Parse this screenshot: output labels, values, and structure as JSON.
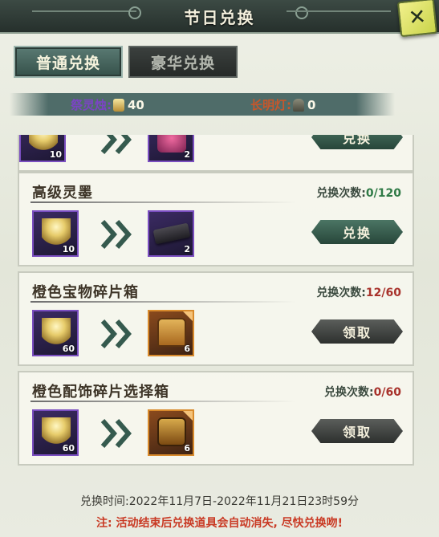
{
  "header": {
    "title": "节日兑换",
    "close_label": "✕"
  },
  "tabs": [
    {
      "label": "普通兑换"
    },
    {
      "label": "豪华兑换"
    }
  ],
  "currency": [
    {
      "label": "祭灵烛:",
      "value": "40",
      "icon": "candle-icon"
    },
    {
      "label": "长明灯:",
      "value": "0",
      "icon": "lamp-icon"
    }
  ],
  "rows": [
    {
      "name": "",
      "count_label": "",
      "count_value": "",
      "input_qty": "10",
      "output_qty": "2",
      "button": "兑换"
    },
    {
      "name": "高级灵墨",
      "count_label": "兑换次数:",
      "count_value": "0/120",
      "input_qty": "10",
      "output_qty": "2",
      "button": "兑换"
    },
    {
      "name": "橙色宝物碎片箱",
      "count_label": "兑换次数:",
      "count_value": "12/60",
      "input_qty": "60",
      "output_qty": "6",
      "button": "领取"
    },
    {
      "name": "橙色配饰碎片选择箱",
      "count_label": "兑换次数:",
      "count_value": "0/60",
      "input_qty": "60",
      "output_qty": "6",
      "button": "领取"
    }
  ],
  "footer": {
    "time": "兑换时间:2022年11月7日-2022年11月21日23时59分",
    "note": "注: 活动结束后兑换道具会自动消失, 尽快兑换吻!"
  }
}
